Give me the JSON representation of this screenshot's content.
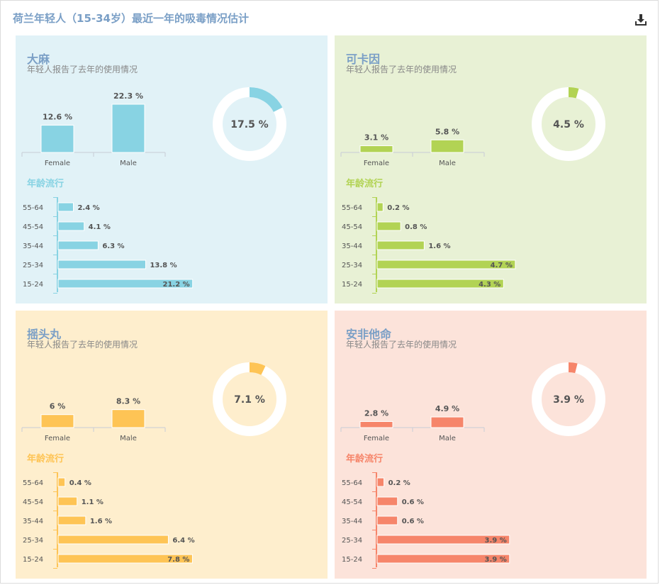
{
  "header": {
    "title": "荷兰年轻人（15-34岁）最近一年的吸毒情况估计",
    "download_icon": "download-icon"
  },
  "colors": {
    "title": "#7a9fc6",
    "text": "#555555"
  },
  "chart_data": [
    {
      "type": "bar",
      "title": "大麻",
      "subtitle": "年轻人报告了去年的使用情况",
      "color": "#88d3e3",
      "background": "#e1f2f7",
      "categories": [
        "Female",
        "Male"
      ],
      "values": [
        12.6,
        22.3
      ],
      "value_labels": [
        "12.6 %",
        "22.3 %"
      ],
      "donut": {
        "value": 17.5,
        "label": "17.5 %"
      },
      "age": {
        "title": "年龄流行",
        "categories": [
          "55-64",
          "45-54",
          "35-44",
          "25-34",
          "15-24"
        ],
        "values": [
          2.4,
          4.1,
          6.3,
          13.8,
          21.2
        ],
        "value_labels": [
          "2.4 %",
          "4.1 %",
          "6.3 %",
          "13.8 %",
          "21.2 %"
        ],
        "label_inside": [
          false,
          false,
          false,
          false,
          true
        ],
        "bar_scale_max": 38
      }
    },
    {
      "type": "bar",
      "title": "可卡因",
      "subtitle": "年轻人报告了去年的使用情况",
      "color": "#b2d354",
      "background": "#e8f1d5",
      "categories": [
        "Female",
        "Male"
      ],
      "values": [
        3.1,
        5.8
      ],
      "value_labels": [
        "3.1 %",
        "5.8 %"
      ],
      "donut": {
        "value": 4.5,
        "label": "4.5 %"
      },
      "age": {
        "title": "年龄流行",
        "categories": [
          "55-64",
          "45-54",
          "35-44",
          "25-34",
          "15-24"
        ],
        "values": [
          0.2,
          0.8,
          1.6,
          4.7,
          4.3
        ],
        "value_labels": [
          "0.2 %",
          "0.8 %",
          "1.6 %",
          "4.7 %",
          "4.3 %"
        ],
        "label_inside": [
          false,
          false,
          false,
          true,
          true
        ],
        "bar_scale_max": 8.2
      }
    },
    {
      "type": "bar",
      "title": "摇头丸",
      "subtitle": "年轻人报告了去年的使用情况",
      "color": "#fec455",
      "background": "#feeecd",
      "categories": [
        "Female",
        "Male"
      ],
      "values": [
        6,
        8.3
      ],
      "value_labels": [
        "6 %",
        "8.3 %"
      ],
      "donut": {
        "value": 7.1,
        "label": "7.1 %"
      },
      "age": {
        "title": "年龄流行",
        "categories": [
          "55-64",
          "45-54",
          "35-44",
          "25-34",
          "15-24"
        ],
        "values": [
          0.4,
          1.1,
          1.6,
          6.4,
          7.8
        ],
        "value_labels": [
          "0.4 %",
          "1.1 %",
          "1.6 %",
          "6.4 %",
          "7.8 %"
        ],
        "label_inside": [
          false,
          false,
          false,
          false,
          true
        ],
        "bar_scale_max": 14
      }
    },
    {
      "type": "bar",
      "title": "安非他命",
      "subtitle": "年轻人报告了去年的使用情况",
      "color": "#f6856a",
      "background": "#fce3da",
      "categories": [
        "Female",
        "Male"
      ],
      "values": [
        2.8,
        4.9
      ],
      "value_labels": [
        "2.8 %",
        "4.9 %"
      ],
      "donut": {
        "value": 3.9,
        "label": "3.9 %"
      },
      "age": {
        "title": "年龄流行",
        "categories": [
          "55-64",
          "45-54",
          "35-44",
          "25-34",
          "15-24"
        ],
        "values": [
          0.2,
          0.6,
          0.6,
          3.9,
          3.9
        ],
        "value_labels": [
          "0.2 %",
          "0.6 %",
          "0.6 %",
          "3.9 %",
          "3.9 %"
        ],
        "label_inside": [
          false,
          false,
          false,
          true,
          true
        ],
        "bar_scale_max": 7.1
      }
    }
  ]
}
